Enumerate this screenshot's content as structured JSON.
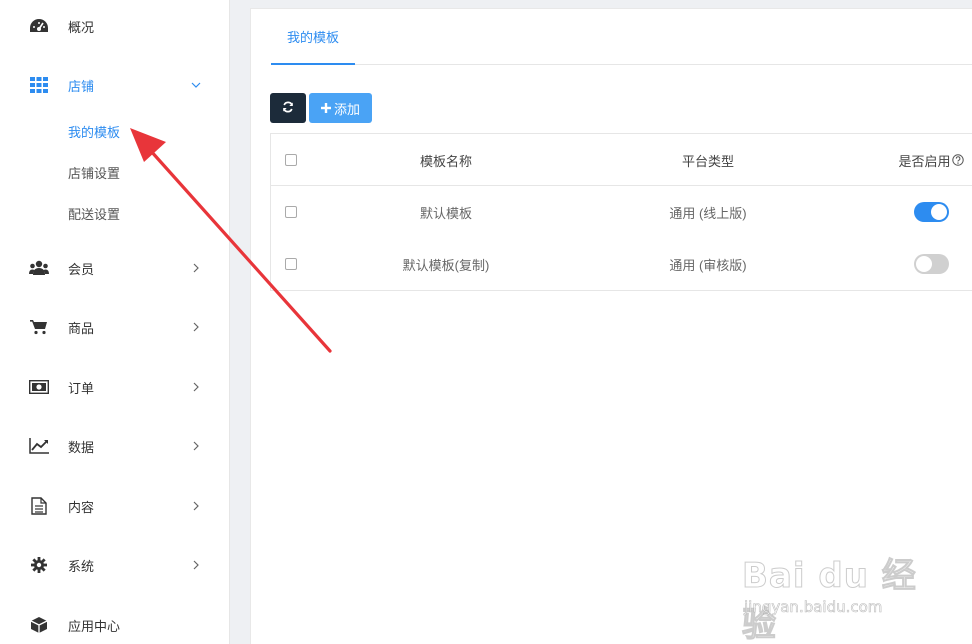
{
  "sidebar": {
    "items": [
      {
        "label": "概况",
        "icon": "dashboard-icon"
      },
      {
        "label": "店铺",
        "icon": "grid-icon",
        "expanded": true,
        "children": [
          {
            "label": "我的模板",
            "active": true
          },
          {
            "label": "店铺设置"
          },
          {
            "label": "配送设置"
          }
        ]
      },
      {
        "label": "会员",
        "icon": "users-icon"
      },
      {
        "label": "商品",
        "icon": "cart-icon"
      },
      {
        "label": "订单",
        "icon": "money-icon"
      },
      {
        "label": "数据",
        "icon": "chart-icon"
      },
      {
        "label": "内容",
        "icon": "document-icon"
      },
      {
        "label": "系统",
        "icon": "gear-icon"
      },
      {
        "label": "应用中心",
        "icon": "box-icon"
      }
    ]
  },
  "main": {
    "tabs": [
      {
        "label": "我的模板",
        "active": true
      }
    ],
    "toolbar": {
      "refresh_icon": "refresh-icon",
      "add_label": "添加"
    },
    "table": {
      "columns": [
        "模板名称",
        "平台类型",
        "是否启用"
      ],
      "rows": [
        {
          "name": "默认模板",
          "platform": "通用 (线上版)",
          "enabled": true
        },
        {
          "name": "默认模板(复制)",
          "platform": "通用 (审核版)",
          "enabled": false
        }
      ]
    }
  },
  "colors": {
    "accent": "#2d8cf0",
    "refresh_button": "#1c2b3a",
    "add_button": "#4aa3f5",
    "annotation_arrow": "#e8353a"
  },
  "watermark": {
    "main": "Bai du 经验",
    "sub": "jingyan.baidu.com"
  }
}
